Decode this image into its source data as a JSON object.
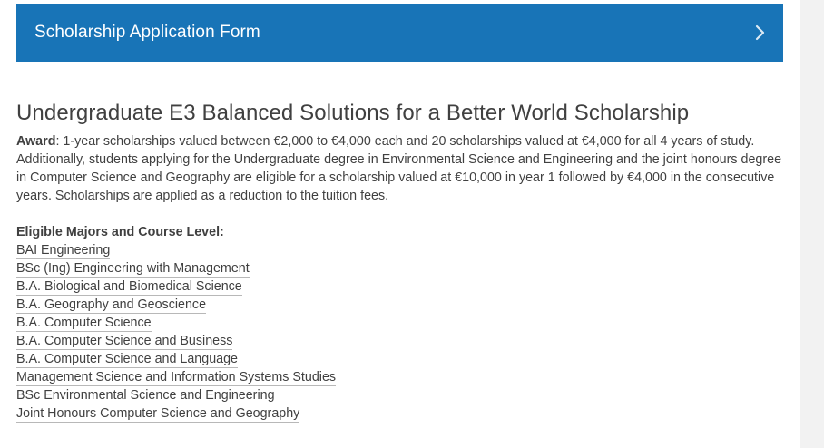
{
  "banner": {
    "title": "Scholarship Application Form",
    "icon": "chevron-right-icon",
    "color": "#1874b7"
  },
  "scholarship": {
    "title": "Undergraduate E3 Balanced Solutions for a Better World Scholarship",
    "award_label": "Award",
    "award_text": ":  1-year scholarships valued between €2,000 to €4,000 each and 20 scholarships valued at €4,000 for all 4 years of study. Additionally, students applying for the Undergraduate degree in Environmental Science and Engineering and the joint honours degree in Computer Science and Geography are eligible for a scholarship valued at €10,000 in year 1 followed by €4,000 in the consecutive years. Scholarships are applied as a reduction to the tuition fees."
  },
  "majors": {
    "heading": "Eligible Majors and Course Level:",
    "items": [
      "BAI Engineering",
      "BSc (Ing) Engineering with Management",
      "B.A. Biological and Biomedical Science",
      "B.A. Geography and Geoscience",
      "B.A. Computer Science",
      "B.A. Computer Science and Business",
      "B.A. Computer Science and Language",
      "Management Science and Information Systems Studies",
      "BSc Environmental Science and Engineering",
      "Joint Honours Computer Science and Geography"
    ]
  }
}
